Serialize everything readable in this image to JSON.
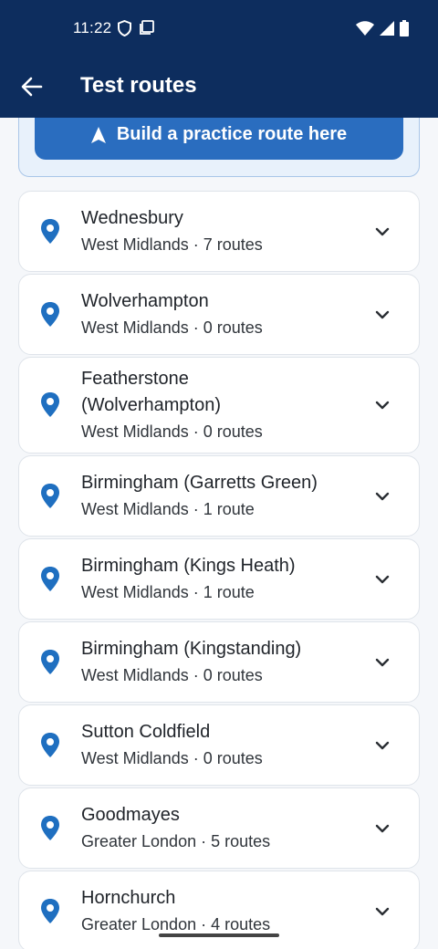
{
  "status_bar": {
    "time": "11:22"
  },
  "header": {
    "title": "Test routes"
  },
  "banner": {
    "button_label": "Build a practice route here"
  },
  "centres": [
    {
      "name": "Wednesbury",
      "region": "West Midlands",
      "routes": "7 routes",
      "subtitle": "West Midlands · 7 routes"
    },
    {
      "name": "Wolverhampton",
      "region": "West Midlands",
      "routes": "0 routes",
      "subtitle": "West Midlands · 0 routes"
    },
    {
      "name": "Featherstone (Wolverhampton)",
      "region": "West Midlands",
      "routes": "0 routes",
      "subtitle": "West Midlands · 0 routes"
    },
    {
      "name": "Birmingham (Garretts Green)",
      "region": "West Midlands",
      "routes": "1 route",
      "subtitle": "West Midlands · 1 route"
    },
    {
      "name": "Birmingham (Kings Heath)",
      "region": "West Midlands",
      "routes": "1 route",
      "subtitle": "West Midlands · 1 route"
    },
    {
      "name": "Birmingham (Kingstanding)",
      "region": "West Midlands",
      "routes": "0 routes",
      "subtitle": "West Midlands · 0 routes"
    },
    {
      "name": "Sutton Coldfield",
      "region": "West Midlands",
      "routes": "0 routes",
      "subtitle": "West Midlands · 0 routes"
    },
    {
      "name": "Goodmayes",
      "region": "Greater London",
      "routes": "5 routes",
      "subtitle": "Greater London · 5 routes"
    },
    {
      "name": "Hornchurch",
      "region": "Greater London",
      "routes": "4 routes",
      "subtitle": "Greater London · 4 routes"
    }
  ],
  "colors": {
    "header_bg": "#0d2d5e",
    "accent": "#2a6dbf",
    "pin": "#1f6fc0"
  },
  "icons": [
    "arrow-back-icon",
    "navigation-arrow-icon",
    "location-pin-icon",
    "chevron-down-icon",
    "wifi-icon",
    "signal-icon",
    "battery-icon"
  ]
}
